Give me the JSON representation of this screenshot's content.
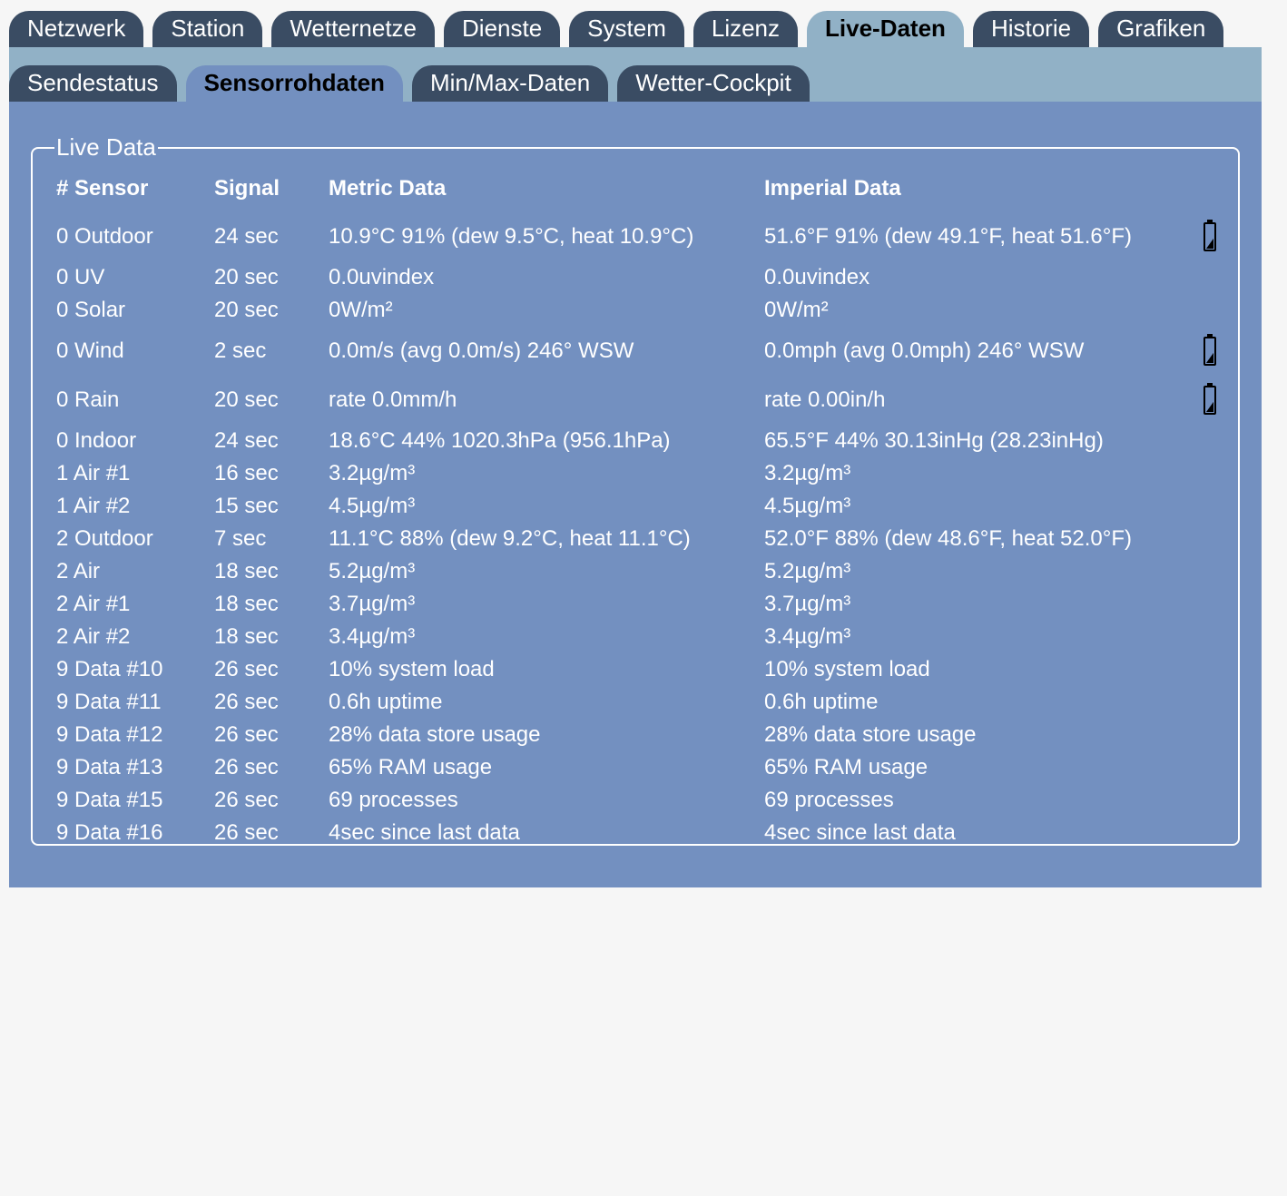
{
  "main_tabs": [
    {
      "label": "Netzwerk",
      "active": false
    },
    {
      "label": "Station",
      "active": false
    },
    {
      "label": "Wetternetze",
      "active": false
    },
    {
      "label": "Dienste",
      "active": false
    },
    {
      "label": "System",
      "active": false
    },
    {
      "label": "Lizenz",
      "active": false
    },
    {
      "label": "Live-Daten",
      "active": true
    },
    {
      "label": "Historie",
      "active": false
    },
    {
      "label": "Grafiken",
      "active": false
    }
  ],
  "sub_tabs": [
    {
      "label": "Sendestatus",
      "active": false
    },
    {
      "label": "Sensorrohdaten",
      "active": true
    },
    {
      "label": "Min/Max-Daten",
      "active": false
    },
    {
      "label": "Wetter-Cockpit",
      "active": false
    }
  ],
  "live": {
    "legend": "Live Data",
    "headers": {
      "sensor": "# Sensor",
      "signal": "Signal",
      "metric": "Metric Data",
      "imperial": "Imperial Data"
    },
    "rows": [
      {
        "sensor": "0 Outdoor",
        "signal": "24 sec",
        "metric": "10.9°C 91% (dew 9.5°C, heat 10.9°C)",
        "imperial": "51.6°F 91% (dew 49.1°F, heat 51.6°F)",
        "battery": true,
        "battery_level": 0.4
      },
      {
        "sensor": "0 UV",
        "signal": "20 sec",
        "metric": "0.0uvindex",
        "imperial": "0.0uvindex",
        "battery": false
      },
      {
        "sensor": "0 Solar",
        "signal": "20 sec",
        "metric": "0W/m²",
        "imperial": "0W/m²",
        "battery": false
      },
      {
        "sensor": "0 Wind",
        "signal": "2 sec",
        "metric": "0.0m/s (avg 0.0m/s) 246° WSW",
        "imperial": "0.0mph (avg 0.0mph) 246° WSW",
        "battery": true,
        "battery_level": 0.4
      },
      {
        "sensor": "0 Rain",
        "signal": "20 sec",
        "metric": "rate 0.0mm/h",
        "imperial": "rate 0.00in/h",
        "battery": true,
        "battery_level": 0.4
      },
      {
        "sensor": "0 Indoor",
        "signal": "24 sec",
        "metric": "18.6°C 44% 1020.3hPa (956.1hPa)",
        "imperial": "65.5°F 44% 30.13inHg (28.23inHg)",
        "battery": false
      },
      {
        "sensor": "1 Air #1",
        "signal": "16 sec",
        "metric": "3.2µg/m³",
        "imperial": "3.2µg/m³",
        "battery": false
      },
      {
        "sensor": "1 Air #2",
        "signal": "15 sec",
        "metric": "4.5µg/m³",
        "imperial": "4.5µg/m³",
        "battery": false
      },
      {
        "sensor": "2 Outdoor",
        "signal": "7 sec",
        "metric": "11.1°C 88% (dew 9.2°C, heat 11.1°C)",
        "imperial": "52.0°F 88% (dew 48.6°F, heat 52.0°F)",
        "battery": false
      },
      {
        "sensor": "2 Air",
        "signal": "18 sec",
        "metric": "5.2µg/m³",
        "imperial": "5.2µg/m³",
        "battery": false
      },
      {
        "sensor": "2 Air #1",
        "signal": "18 sec",
        "metric": "3.7µg/m³",
        "imperial": "3.7µg/m³",
        "battery": false
      },
      {
        "sensor": "2 Air #2",
        "signal": "18 sec",
        "metric": "3.4µg/m³",
        "imperial": "3.4µg/m³",
        "battery": false
      },
      {
        "sensor": "9 Data #10",
        "signal": "26 sec",
        "metric": "10% system load",
        "imperial": "10% system load",
        "battery": false
      },
      {
        "sensor": "9 Data #11",
        "signal": "26 sec",
        "metric": "0.6h uptime",
        "imperial": "0.6h uptime",
        "battery": false
      },
      {
        "sensor": "9 Data #12",
        "signal": "26 sec",
        "metric": "28% data store usage",
        "imperial": "28% data store usage",
        "battery": false
      },
      {
        "sensor": "9 Data #13",
        "signal": "26 sec",
        "metric": "65% RAM usage",
        "imperial": "65% RAM usage",
        "battery": false
      },
      {
        "sensor": "9 Data #15",
        "signal": "26 sec",
        "metric": "69 processes",
        "imperial": "69 processes",
        "battery": false
      },
      {
        "sensor": "9 Data #16",
        "signal": "26 sec",
        "metric": "4sec since last data",
        "imperial": "4sec since last data",
        "battery": false
      }
    ]
  },
  "colors": {
    "tab_inactive": "#3a4c63",
    "tab_active": "#91b1c6",
    "subbar_bg": "#91b1c6",
    "panel_bg": "#7390c0",
    "page_bg": "#f6f6f6"
  },
  "icons": {
    "battery": "battery-icon"
  }
}
